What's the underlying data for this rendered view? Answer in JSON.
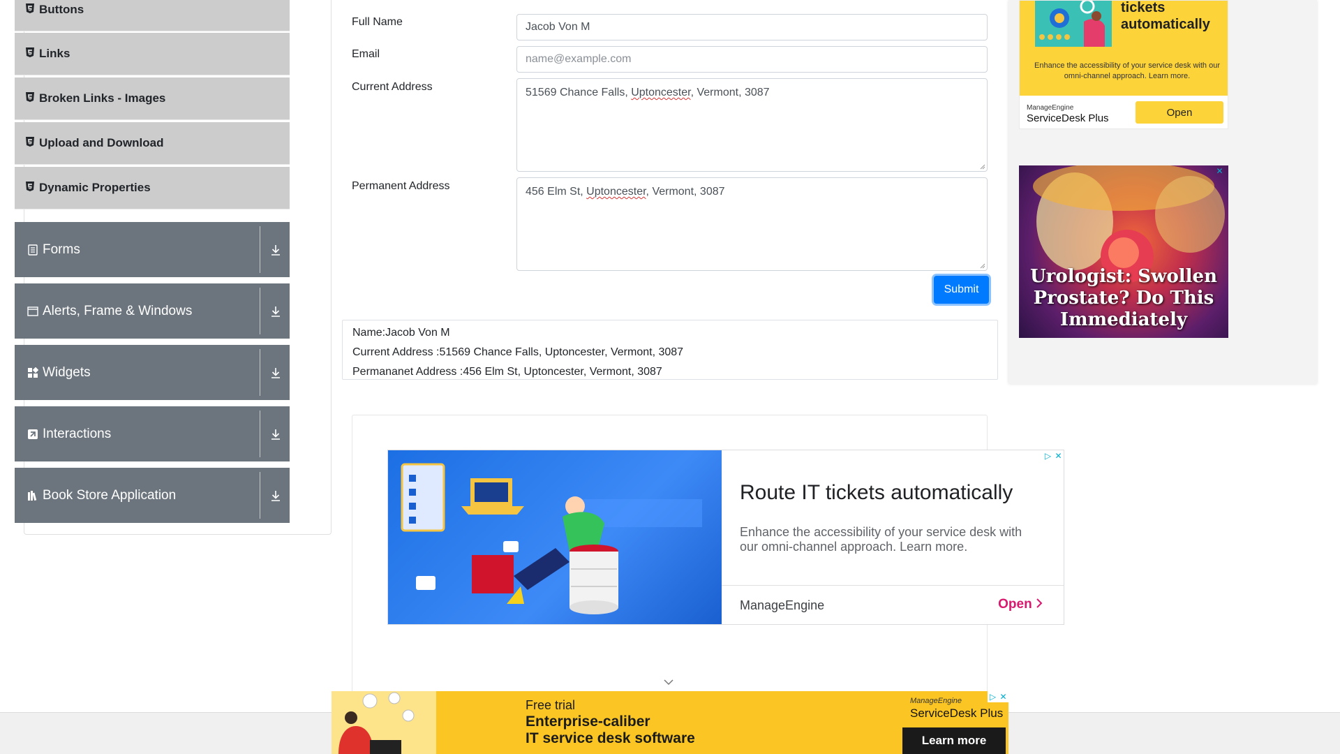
{
  "sidebar": {
    "sub_items": [
      {
        "label": "Buttons"
      },
      {
        "label": "Links"
      },
      {
        "label": "Broken Links - Images"
      },
      {
        "label": "Upload and Download"
      },
      {
        "label": "Dynamic Properties"
      }
    ],
    "groups": [
      {
        "label": "Forms",
        "icon": "form-icon"
      },
      {
        "label": "Alerts, Frame & Windows",
        "icon": "window-icon"
      },
      {
        "label": "Widgets",
        "icon": "widgets-icon"
      },
      {
        "label": "Interactions",
        "icon": "interactions-icon"
      },
      {
        "label": "Book Store Application",
        "icon": "bookstore-icon"
      }
    ]
  },
  "form": {
    "full_name_label": "Full Name",
    "full_name_value": "Jacob Von M",
    "email_label": "Email",
    "email_placeholder": "name@example.com",
    "current_address_label": "Current Address",
    "current_address_parts": [
      "51569 Chance Falls, ",
      "Uptoncester",
      ", Vermont, 3087"
    ],
    "permanent_address_label": "Permanent Address",
    "permanent_address_parts": [
      "456 Elm St, ",
      "Uptoncester",
      ", Vermont, 3087"
    ],
    "submit_label": "Submit"
  },
  "output": {
    "name": "Name:Jacob Von M",
    "current_address": "Current Address :51569 Chance Falls, Uptoncester, Vermont, 3087",
    "permanent_address": "Permananet Address :456 Elm St, Uptoncester, Vermont, 3087"
  },
  "ads": {
    "main": {
      "title": "Route IT tickets automatically",
      "description": "Enhance the accessibility of your service desk with our omni-channel approach. Learn more.",
      "brand": "ManageEngine",
      "cta": "Open"
    },
    "right_top": {
      "title_line1": "tickets",
      "title_line2": "automatically",
      "description": "Enhance the accessibility of your service desk with our omni-channel approach. Learn more.",
      "brand_small": "ManageEngine",
      "product": "ServiceDesk Plus",
      "cta": "Open"
    },
    "right_med": {
      "line1": "Urologist: Swollen",
      "line2": "Prostate? Do This",
      "line3": "Immediately"
    },
    "bottom": {
      "free_trial": "Free trial",
      "headline1": "Enterprise-caliber",
      "headline2": "IT service desk software",
      "brand_small": "ManageEngine",
      "product": "ServiceDesk Plus",
      "cta": "Learn more"
    }
  }
}
